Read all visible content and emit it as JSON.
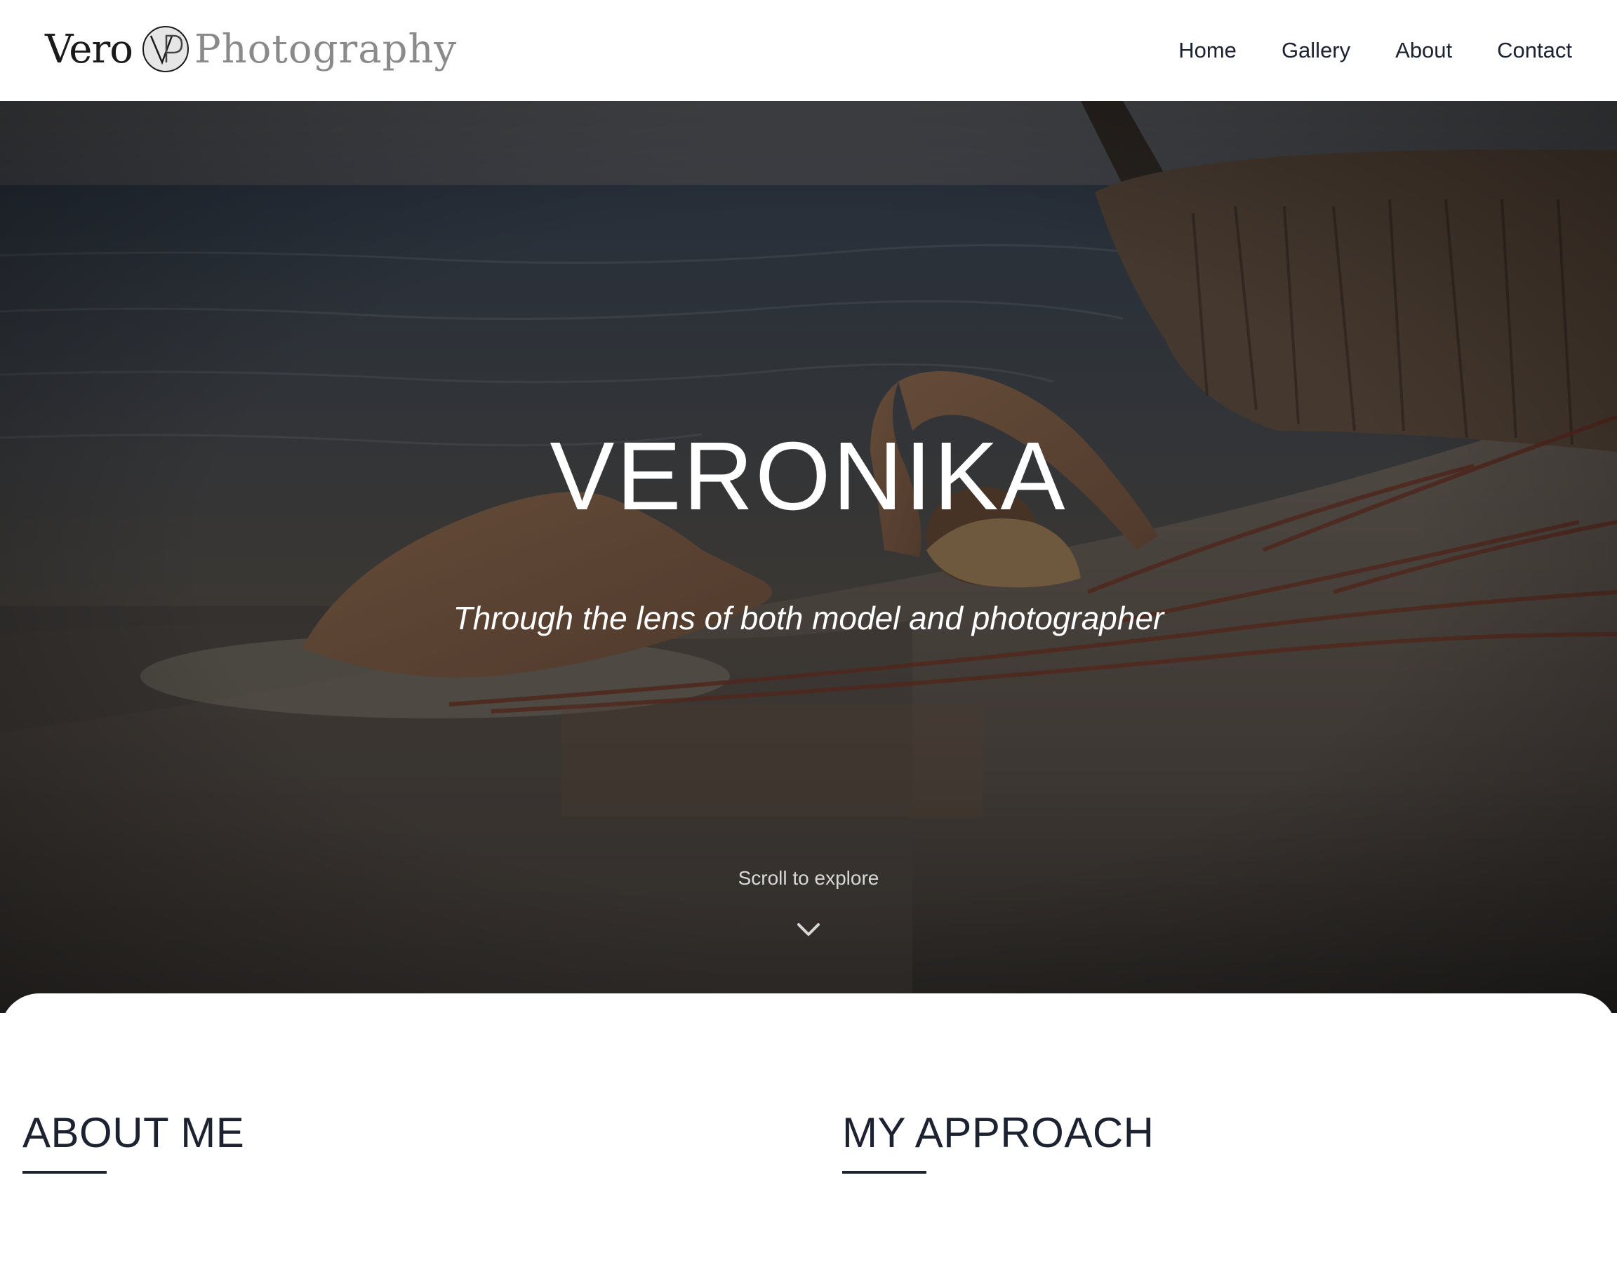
{
  "header": {
    "logo": {
      "word_left": "Vero",
      "monogram": "VP",
      "word_right": "Photography"
    },
    "nav": [
      {
        "label": "Home"
      },
      {
        "label": "Gallery"
      },
      {
        "label": "About"
      },
      {
        "label": "Contact"
      }
    ]
  },
  "hero": {
    "title": "VERONIKA",
    "subtitle": "Through the lens of both model and photographer",
    "scroll_hint": "Scroll to explore",
    "scroll_icon": "chevron-down-icon",
    "image_description_icon": "beach-photo"
  },
  "sections": {
    "about": {
      "heading": "ABOUT ME"
    },
    "approach": {
      "heading": "MY APPROACH"
    }
  },
  "colors": {
    "text_dark": "#1c2230",
    "header_bg": "#ffffff",
    "hero_overlay": "#2b2a28",
    "logo_grey": "#8a8a8a"
  }
}
